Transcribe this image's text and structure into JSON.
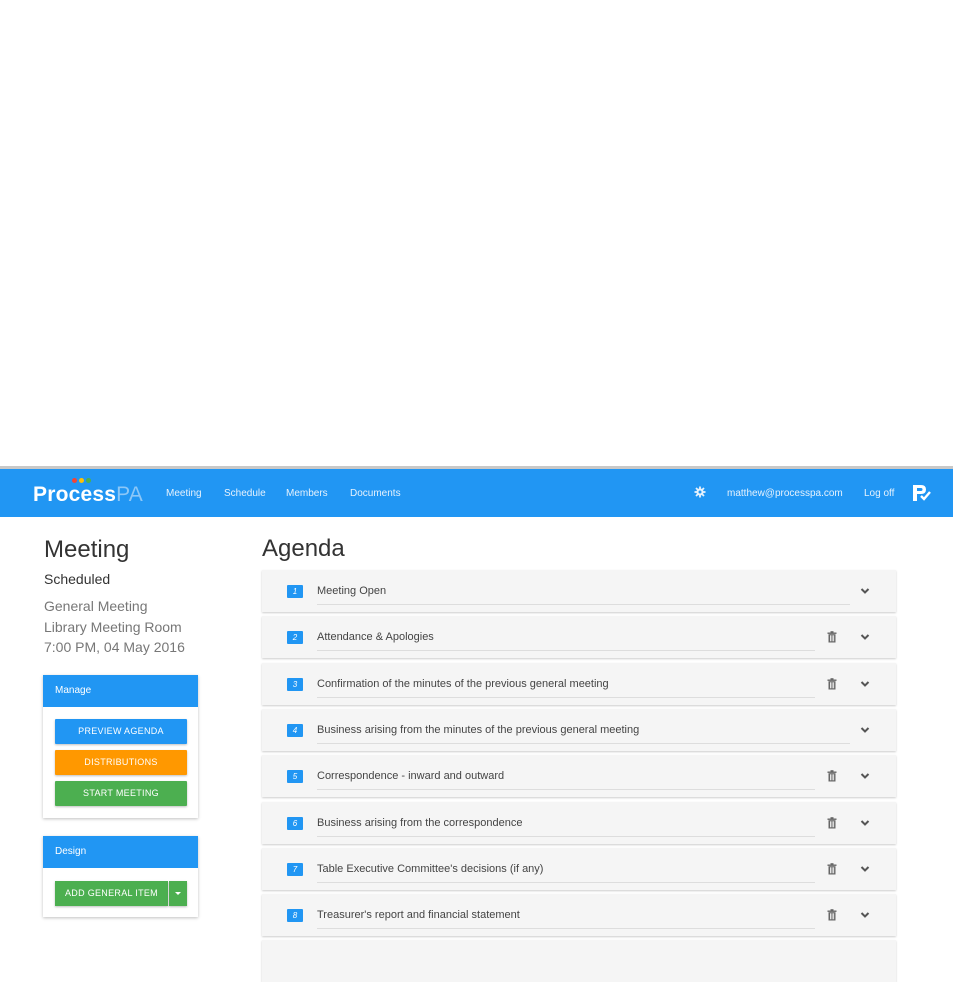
{
  "brand": {
    "name_bold": "Process",
    "name_light": "PA",
    "dot_colors": [
      "#f44336",
      "#ffc107",
      "#4caf50"
    ]
  },
  "nav": {
    "links": [
      "Meeting",
      "Schedule",
      "Members",
      "Documents"
    ],
    "user_email": "matthew@processpa.com",
    "logoff": "Log off"
  },
  "meeting": {
    "title": "Meeting",
    "status": "Scheduled",
    "type": "General Meeting",
    "location": "Library Meeting Room",
    "datetime": "7:00 PM, 04 May 2016"
  },
  "manage": {
    "heading": "Manage",
    "preview": "PREVIEW AGENDA",
    "distributions": "DISTRIBUTIONS",
    "start": "START MEETING"
  },
  "design": {
    "heading": "Design",
    "add": "ADD GENERAL ITEM"
  },
  "agenda": {
    "title": "Agenda",
    "items": [
      {
        "num": "1",
        "text": "Meeting Open",
        "deletable": false
      },
      {
        "num": "2",
        "text": "Attendance & Apologies",
        "deletable": true
      },
      {
        "num": "3",
        "text": "Confirmation of the minutes of the previous general meeting",
        "deletable": true
      },
      {
        "num": "4",
        "text": "Business arising from the minutes of the previous general meeting",
        "deletable": false
      },
      {
        "num": "5",
        "text": "Correspondence - inward and outward",
        "deletable": true
      },
      {
        "num": "6",
        "text": "Business arising from the correspondence",
        "deletable": true
      },
      {
        "num": "7",
        "text": "Table Executive Committee's decisions (if any)",
        "deletable": true
      },
      {
        "num": "8",
        "text": "Treasurer's report and financial statement",
        "deletable": true
      }
    ]
  },
  "colors": {
    "primary": "#2196f3",
    "warning": "#ff9800",
    "success": "#4caf50"
  }
}
